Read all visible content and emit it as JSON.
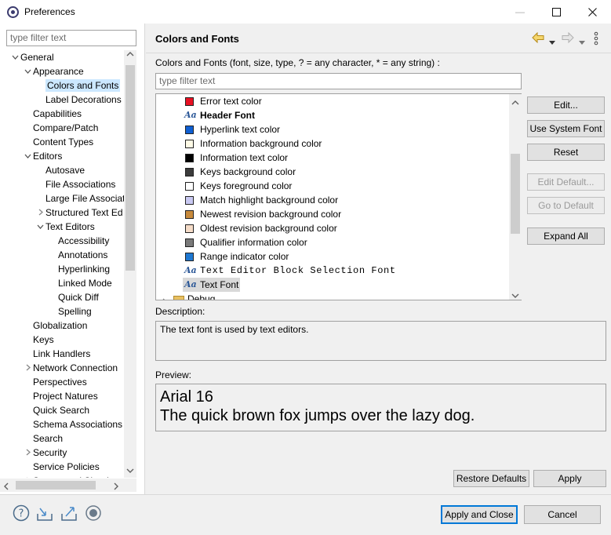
{
  "window": {
    "title": "Preferences",
    "min_glyph": "—",
    "max_glyph": "☐",
    "close_glyph": "✕"
  },
  "left": {
    "filter_placeholder": "type filter text",
    "tree": [
      {
        "label": "General",
        "depth": 0,
        "twisty": "expanded"
      },
      {
        "label": "Appearance",
        "depth": 1,
        "twisty": "expanded"
      },
      {
        "label": "Colors and Fonts",
        "depth": 2,
        "twisty": "none",
        "selected": true
      },
      {
        "label": "Label Decorations",
        "depth": 2,
        "twisty": "none"
      },
      {
        "label": "Capabilities",
        "depth": 1,
        "twisty": "none"
      },
      {
        "label": "Compare/Patch",
        "depth": 1,
        "twisty": "none"
      },
      {
        "label": "Content Types",
        "depth": 1,
        "twisty": "none"
      },
      {
        "label": "Editors",
        "depth": 1,
        "twisty": "expanded"
      },
      {
        "label": "Autosave",
        "depth": 2,
        "twisty": "none"
      },
      {
        "label": "File Associations",
        "depth": 2,
        "twisty": "none"
      },
      {
        "label": "Large File Associat",
        "depth": 2,
        "twisty": "none"
      },
      {
        "label": "Structured Text Ed",
        "depth": 2,
        "twisty": "collapsed"
      },
      {
        "label": "Text Editors",
        "depth": 2,
        "twisty": "expanded"
      },
      {
        "label": "Accessibility",
        "depth": 3,
        "twisty": "none"
      },
      {
        "label": "Annotations",
        "depth": 3,
        "twisty": "none"
      },
      {
        "label": "Hyperlinking",
        "depth": 3,
        "twisty": "none"
      },
      {
        "label": "Linked Mode",
        "depth": 3,
        "twisty": "none"
      },
      {
        "label": "Quick Diff",
        "depth": 3,
        "twisty": "none"
      },
      {
        "label": "Spelling",
        "depth": 3,
        "twisty": "none"
      },
      {
        "label": "Globalization",
        "depth": 1,
        "twisty": "none"
      },
      {
        "label": "Keys",
        "depth": 1,
        "twisty": "none"
      },
      {
        "label": "Link Handlers",
        "depth": 1,
        "twisty": "none"
      },
      {
        "label": "Network Connection",
        "depth": 1,
        "twisty": "collapsed"
      },
      {
        "label": "Perspectives",
        "depth": 1,
        "twisty": "none"
      },
      {
        "label": "Project Natures",
        "depth": 1,
        "twisty": "none"
      },
      {
        "label": "Quick Search",
        "depth": 1,
        "twisty": "none"
      },
      {
        "label": "Schema Associations",
        "depth": 1,
        "twisty": "none"
      },
      {
        "label": "Search",
        "depth": 1,
        "twisty": "none"
      },
      {
        "label": "Security",
        "depth": 1,
        "twisty": "collapsed"
      },
      {
        "label": "Service Policies",
        "depth": 1,
        "twisty": "none"
      },
      {
        "label": "Startup and Shutdow",
        "depth": 1,
        "twisty": "collapsed"
      }
    ]
  },
  "page": {
    "title": "Colors and Fonts",
    "description": "Colors and Fonts (font, size, type, ? = any character, * = any string) :",
    "filter_placeholder": "type filter text",
    "items": [
      {
        "label": "Error text color",
        "kind": "color",
        "color": "#e81123"
      },
      {
        "label": "Header Font",
        "kind": "font",
        "style": "bold"
      },
      {
        "label": "Hyperlink text color",
        "kind": "color",
        "color": "#0f5fd2"
      },
      {
        "label": "Information background color",
        "kind": "color",
        "color": "#fffbe6"
      },
      {
        "label": "Information text color",
        "kind": "color",
        "color": "#000000"
      },
      {
        "label": "Keys background color",
        "kind": "color",
        "color": "#3c3c3c"
      },
      {
        "label": "Keys foreground color",
        "kind": "color",
        "color": "#ffffff"
      },
      {
        "label": "Match highlight background color",
        "kind": "color",
        "color": "#c9c9f2"
      },
      {
        "label": "Newest revision background color",
        "kind": "color",
        "color": "#c88a3c"
      },
      {
        "label": "Oldest revision background color",
        "kind": "color",
        "color": "#f5dcc8"
      },
      {
        "label": "Qualifier information color",
        "kind": "color",
        "color": "#7a7a7a"
      },
      {
        "label": "Range indicator color",
        "kind": "color",
        "color": "#1e78d2"
      },
      {
        "label": "Text Editor Block Selection Font",
        "kind": "font",
        "style": "mono"
      },
      {
        "label": "Text Font",
        "kind": "font",
        "style": "normal",
        "selected": true
      },
      {
        "label": "Debug",
        "kind": "folder"
      }
    ],
    "font_icon_text": "Aa",
    "buttons": {
      "edit": "Edit...",
      "use_system_font": "Use System Font",
      "reset": "Reset",
      "edit_default": "Edit Default...",
      "go_to_default": "Go to Default",
      "expand_all": "Expand All"
    },
    "description_label": "Description:",
    "description_text": "The text font is used by text editors.",
    "preview_label": "Preview:",
    "preview_line1": "Arial 16",
    "preview_line2": "The quick brown fox jumps over the lazy dog.",
    "restore_defaults": "Restore Defaults",
    "apply": "Apply"
  },
  "footer": {
    "apply_and_close": "Apply and Close",
    "cancel": "Cancel"
  }
}
